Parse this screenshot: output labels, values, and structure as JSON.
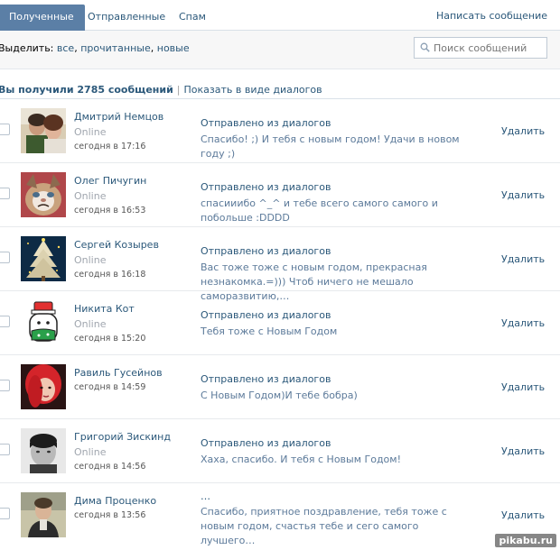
{
  "tabs": [
    {
      "label": "Полученные"
    },
    {
      "label": "Отправленные"
    },
    {
      "label": "Спам"
    }
  ],
  "write_message": "Написать сообщение",
  "filter": {
    "label": "Выделить:",
    "all": "все",
    "read": "прочитанные",
    "new": "новые"
  },
  "search": {
    "placeholder": "Поиск сообщений"
  },
  "summary": {
    "count_text": "Вы получили 2785 сообщений",
    "separator": "|",
    "dialog_link": "Показать в виде диалогов"
  },
  "messages": [
    {
      "name": "Дмитрий Немцов",
      "online": "Online",
      "time": "сегодня в 17:16",
      "title": "Отправлено из диалогов",
      "text": "Спасибо! ;) И тебя с новым годом! Удачи в новом году ;)",
      "delete": "Удалить"
    },
    {
      "name": "Олег Пичугин",
      "online": "Online",
      "time": "сегодня в 16:53",
      "title": "Отправлено из диалогов",
      "text": "спасииибо ^_^ и тебе всего самого самого и побольше :DDDD",
      "delete": "Удалить"
    },
    {
      "name": "Сергей Козырев",
      "online": "Online",
      "time": "сегодня в 16:18",
      "title": "Отправлено из диалогов",
      "text": "Вас тоже тоже с новым годом, прекрасная незнакомка.=))) Чтоб ничего не мешало саморазвитию,…",
      "delete": "Удалить"
    },
    {
      "name": "Никита Кот",
      "online": "Online",
      "time": "сегодня в 15:20",
      "title": "Отправлено из диалогов",
      "text": "Тебя тоже с Новым Годом",
      "delete": "Удалить"
    },
    {
      "name": "Равиль Гусейнов",
      "online": "",
      "time": "сегодня в 14:59",
      "title": "Отправлено из диалогов",
      "text": "С Новым Годом)И тебе бобра)",
      "delete": "Удалить"
    },
    {
      "name": "Григорий Зискинд",
      "online": "Online",
      "time": "сегодня в 14:56",
      "title": "Отправлено из диалогов",
      "text": "Хаха, спасибо. И тебя с Новым Годом!",
      "delete": "Удалить"
    },
    {
      "name": "Дима Проценко",
      "online": "",
      "time": "сегодня в 13:56",
      "title": "…",
      "text": "Спасибо, приятное поздравление, тебя тоже с новым годом, счастья тебе и сего самого лучшего…",
      "delete": "Удалить"
    }
  ],
  "icons": {
    "search": "search-icon"
  },
  "colors": {
    "link": "#2b587a",
    "tab_active": "#5b7fa6",
    "message_text": "#5c7a9a"
  },
  "watermark": "pikabu.ru"
}
